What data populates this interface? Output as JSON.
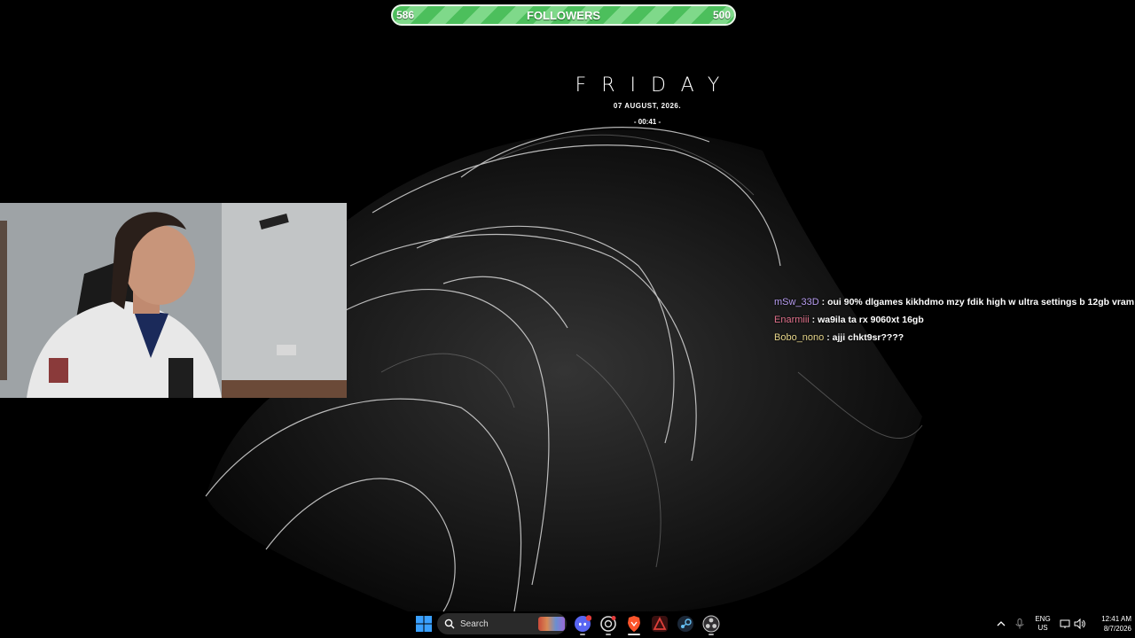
{
  "follower_goal": {
    "current": "586",
    "label": "FOLLOWERS",
    "target": "500",
    "progress_fraction": 1.0,
    "colors": {
      "fill": "#4cbf5c",
      "stripe": "#7fd98a",
      "border": "#e8f5e8"
    }
  },
  "date_widget": {
    "day": "FRIDAY",
    "date": "07 AUGUST, 2026.",
    "time": "- 00:41 -"
  },
  "chat": {
    "messages": [
      {
        "user": "mSw_33D",
        "separator": " : ",
        "text": "oui 90% dlgames kikhdmo mzy fdik high w ultra settings b 12gb vram",
        "color": "#b79cf0"
      },
      {
        "user": "Enarmiii",
        "separator": " : ",
        "text": "wa9ila ta rx 9060xt 16gb",
        "color": "#e0708a"
      },
      {
        "user": "Bobo_nono",
        "separator": " : ",
        "text": "ajji chkt9sr????",
        "color": "#e6d58a"
      }
    ]
  },
  "taskbar": {
    "search_label": "Search",
    "apps": [
      {
        "icon": "discord-icon",
        "badge": "9+"
      },
      {
        "icon": "chatgpt-icon"
      },
      {
        "icon": "brave-icon"
      },
      {
        "icon": "affinity-icon"
      },
      {
        "icon": "steam-icon"
      },
      {
        "icon": "obs-icon"
      }
    ],
    "tray": {
      "lang_top": "ENG",
      "lang_bottom": "US",
      "time": "12:41 AM",
      "date": "8/7/2026"
    }
  }
}
